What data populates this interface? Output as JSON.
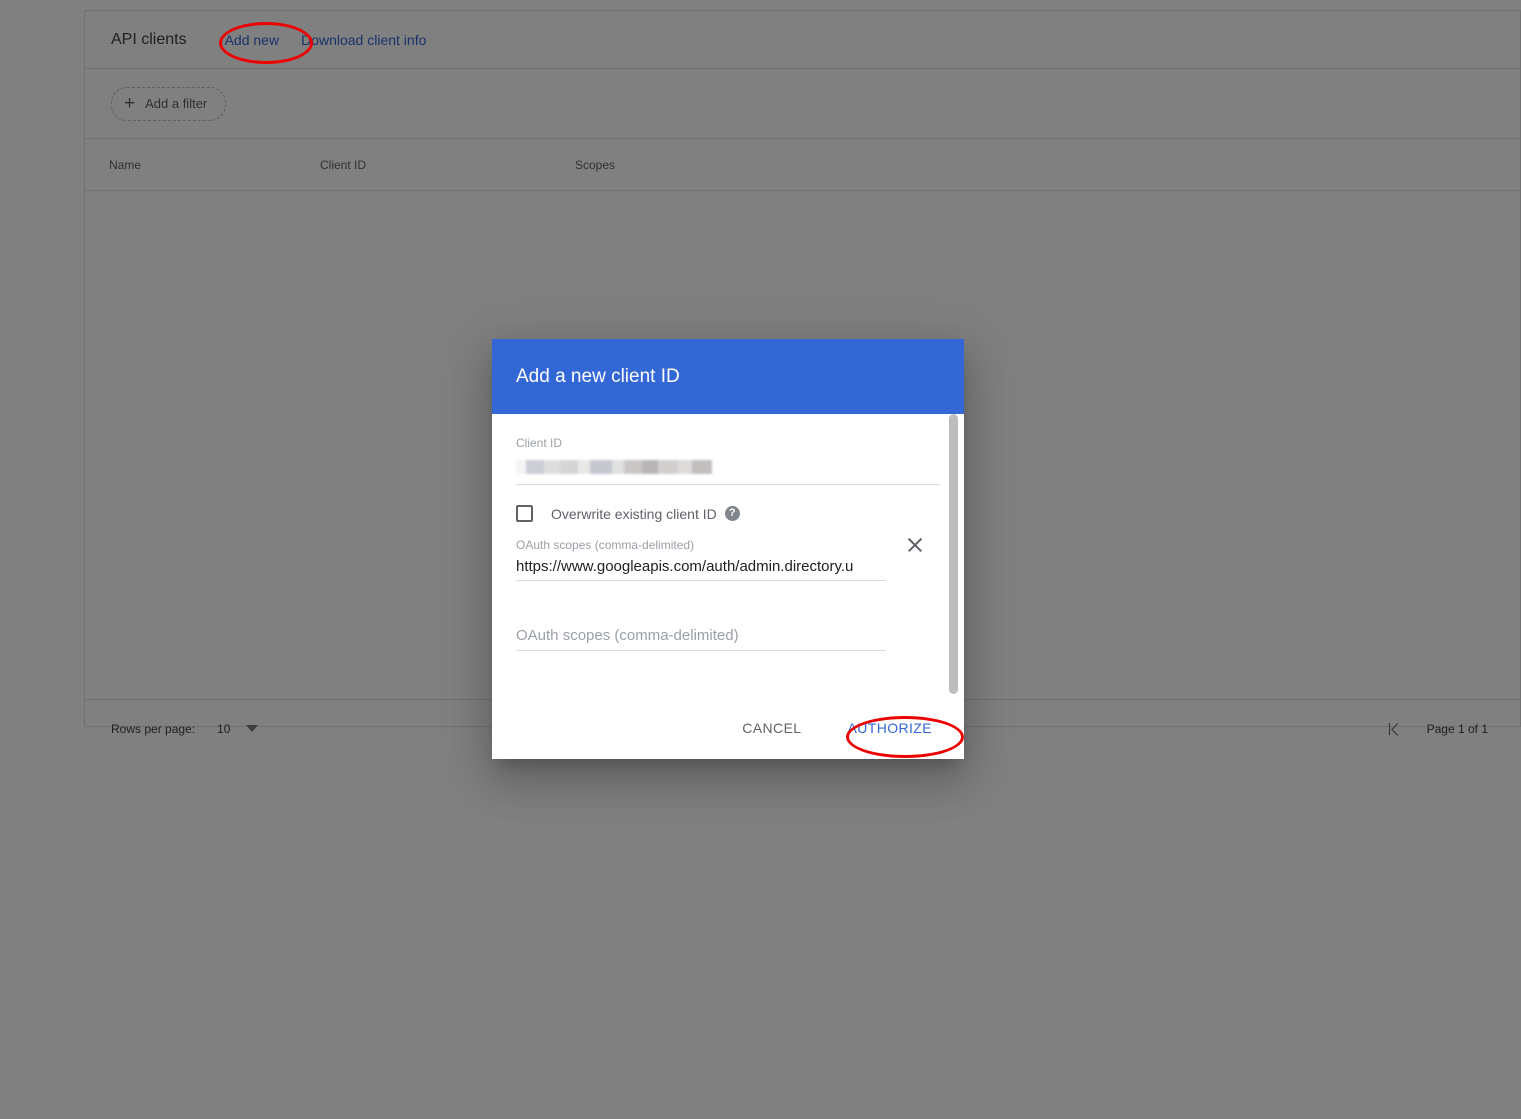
{
  "page": {
    "card": {
      "title": "API clients",
      "links": [
        {
          "label": "Add new"
        },
        {
          "label": "Download client info"
        }
      ],
      "filter": {
        "label": "Add a filter",
        "plus_glyph": "+"
      },
      "table": {
        "columns": [
          "Name",
          "Client ID",
          "Scopes"
        ],
        "rows": []
      },
      "footer": {
        "rows_per_page_label": "Rows per page:",
        "rows_per_page_value": "10",
        "first_page_icon": "first-page-icon",
        "page_indicator": "Page 1 of 1"
      }
    }
  },
  "dialog": {
    "title": "Add a new client ID",
    "client_id": {
      "label": "Client ID",
      "value": "",
      "redacted": true
    },
    "overwrite": {
      "label": "Overwrite existing client ID",
      "checked": false,
      "help_glyph": "?"
    },
    "scope_filled": {
      "label": "OAuth scopes (comma-delimited)",
      "value": "https://www.googleapis.com/auth/admin.directory.u",
      "clear_icon": "close-icon"
    },
    "scope_empty": {
      "label": "OAuth scopes (comma-delimited)",
      "placeholder": "OAuth scopes (comma-delimited)",
      "value": ""
    },
    "actions": {
      "cancel": "CANCEL",
      "authorize": "AUTHORIZE"
    }
  },
  "annotations": {
    "color": "#ec0000",
    "targets": [
      "Add new",
      "AUTHORIZE"
    ]
  },
  "colors": {
    "dialog_header": "#3367d6",
    "link": "#3367d6",
    "annotation": "#ec0000",
    "scrim": "rgba(0,0,0,0.5)"
  }
}
